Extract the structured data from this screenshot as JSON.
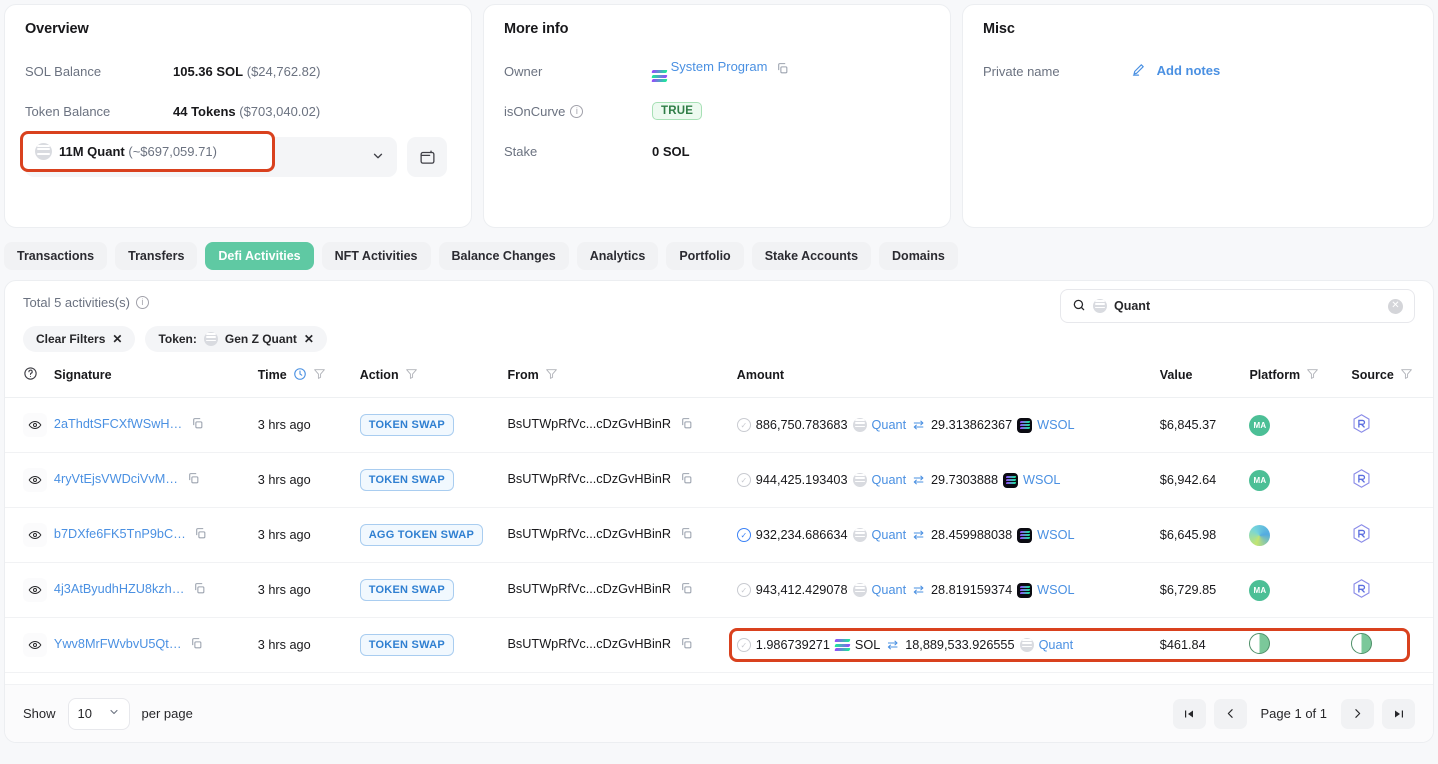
{
  "overview": {
    "title": "Overview",
    "sol_balance_label": "SOL Balance",
    "sol_balance_value": "105.36 SOL",
    "sol_balance_usd": "($24,762.82)",
    "token_balance_label": "Token Balance",
    "token_balance_value": "44 Tokens",
    "token_balance_usd": "($703,040.02)",
    "token_select_value": "11M Quant",
    "token_select_usd": "(~$697,059.71)",
    "token_icon": "quant-token-icon",
    "chevron_icon": "chevron-down-icon",
    "wallet_icon": "wallet-icon"
  },
  "more_info": {
    "title": "More info",
    "owner_label": "Owner",
    "owner_value": "System Program",
    "owner_icon": "solana-icon",
    "owner_copy_icon": "copy-icon",
    "iscurve_label": "isOnCurve",
    "iscurve_info_icon": "info-icon",
    "iscurve_value": "TRUE",
    "stake_label": "Stake",
    "stake_value": "0 SOL"
  },
  "misc": {
    "title": "Misc",
    "private_name_label": "Private name",
    "add_notes_label": "Add notes",
    "edit_icon": "pencil-icon"
  },
  "tabs": [
    {
      "label": "Transactions",
      "active": false
    },
    {
      "label": "Transfers",
      "active": false
    },
    {
      "label": "Defi Activities",
      "active": true
    },
    {
      "label": "NFT Activities",
      "active": false
    },
    {
      "label": "Balance Changes",
      "active": false
    },
    {
      "label": "Analytics",
      "active": false
    },
    {
      "label": "Portfolio",
      "active": false
    },
    {
      "label": "Stake Accounts",
      "active": false
    },
    {
      "label": "Domains",
      "active": false
    }
  ],
  "panel": {
    "total_text": "Total 5 activities(s)",
    "total_info_icon": "info-icon",
    "clear_filters_label": "Clear Filters",
    "clear_filters_x": "✕",
    "token_filter_prefix": "Token:",
    "token_filter_value": "Gen Z Quant",
    "token_filter_x": "✕",
    "search_icon": "search-icon",
    "search_value": "Quant",
    "search_clear_icon": "clear-icon"
  },
  "table": {
    "columns": {
      "eye": "",
      "signature": "Signature",
      "time": "Time",
      "action": "Action",
      "from": "From",
      "amount": "Amount",
      "value": "Value",
      "platform": "Platform",
      "source": "Source"
    },
    "header_icons": {
      "help": "question-circle-icon",
      "time_clock": "clock-icon",
      "time_filter": "filter-icon",
      "action_filter": "filter-icon",
      "from_filter": "filter-icon",
      "platform_filter": "filter-icon",
      "source_filter": "filter-icon"
    },
    "rows": [
      {
        "eye_icon": "eye-icon",
        "signature": "2aThdtSFCXfWSwH…",
        "copy_icon": "copy-icon",
        "time": "3 hrs ago",
        "action": "TOKEN SWAP",
        "from": "BsUTWpRfVc...cDzGvHBinR",
        "from_copy_icon": "copy-icon",
        "amount_status": "pending",
        "amount_in": "886,750.783683",
        "token_in": "Quant",
        "token_in_icon": "quant-token-icon",
        "swap_icon": "swap-arrows-icon",
        "amount_out": "29.313862367",
        "token_out": "WSOL",
        "token_out_icon": "wsol-token-icon",
        "value": "$6,845.37",
        "platform_icon": "meteora-avatar",
        "platform_label": "MA",
        "source_icon": "raydium-hex-icon",
        "highlighted": false
      },
      {
        "eye_icon": "eye-icon",
        "signature": "4ryVtEjsVWDciVvM…",
        "copy_icon": "copy-icon",
        "time": "3 hrs ago",
        "action": "TOKEN SWAP",
        "from": "BsUTWpRfVc...cDzGvHBinR",
        "from_copy_icon": "copy-icon",
        "amount_status": "pending",
        "amount_in": "944,425.193403",
        "token_in": "Quant",
        "token_in_icon": "quant-token-icon",
        "swap_icon": "swap-arrows-icon",
        "amount_out": "29.7303888",
        "token_out": "WSOL",
        "token_out_icon": "wsol-token-icon",
        "value": "$6,942.64",
        "platform_icon": "meteora-avatar",
        "platform_label": "MA",
        "source_icon": "raydium-hex-icon",
        "highlighted": false
      },
      {
        "eye_icon": "eye-icon",
        "signature": "b7DXfe6FK5TnP9bC…",
        "copy_icon": "copy-icon",
        "time": "3 hrs ago",
        "action": "AGG TOKEN SWAP",
        "from": "BsUTWpRfVc...cDzGvHBinR",
        "from_copy_icon": "copy-icon",
        "amount_status": "confirmed",
        "amount_in": "932,234.686634",
        "token_in": "Quant",
        "token_in_icon": "quant-token-icon",
        "swap_icon": "swap-arrows-icon",
        "amount_out": "28.459988038",
        "token_out": "WSOL",
        "token_out_icon": "wsol-token-icon",
        "value": "$6,645.98",
        "platform_icon": "jupiter-wave-icon",
        "platform_label": "",
        "source_icon": "raydium-hex-icon",
        "highlighted": false
      },
      {
        "eye_icon": "eye-icon",
        "signature": "4j3AtByudhHZU8kzh…",
        "copy_icon": "copy-icon",
        "time": "3 hrs ago",
        "action": "TOKEN SWAP",
        "from": "BsUTWpRfVc...cDzGvHBinR",
        "from_copy_icon": "copy-icon",
        "amount_status": "pending",
        "amount_in": "943,412.429078",
        "token_in": "Quant",
        "token_in_icon": "quant-token-icon",
        "swap_icon": "swap-arrows-icon",
        "amount_out": "28.819159374",
        "token_out": "WSOL",
        "token_out_icon": "wsol-token-icon",
        "value": "$6,729.85",
        "platform_icon": "meteora-avatar",
        "platform_label": "MA",
        "source_icon": "raydium-hex-icon",
        "highlighted": false
      },
      {
        "eye_icon": "eye-icon",
        "signature": "Ywv8MrFWvbvU5Qt…",
        "copy_icon": "copy-icon",
        "time": "3 hrs ago",
        "action": "TOKEN SWAP",
        "from": "BsUTWpRfVc...cDzGvHBinR",
        "from_copy_icon": "copy-icon",
        "amount_status": "pending",
        "amount_in": "1.986739271",
        "token_in": "SOL",
        "token_in_icon": "solana-icon",
        "swap_icon": "swap-arrows-icon",
        "amount_out": "18,889,533.926555",
        "token_out": "Quant",
        "token_out_icon": "quant-token-icon",
        "value": "$461.84",
        "platform_icon": "pill-icon",
        "platform_label": "",
        "source_icon": "pill-icon",
        "highlighted": true
      }
    ]
  },
  "footer": {
    "show_label": "Show",
    "per_page_value": "10",
    "per_page_chevron": "chevron-down-icon",
    "per_page_label": "per page",
    "first_icon": "first-page-icon",
    "prev_icon": "prev-page-icon",
    "page_text": "Page 1 of 1",
    "next_icon": "next-page-icon",
    "last_icon": "last-page-icon"
  },
  "colors": {
    "accent_green": "#5fc9a3",
    "link_blue": "#4a90e2",
    "highlight_red": "#d9411e",
    "badge_green_text": "#2f7d46"
  }
}
